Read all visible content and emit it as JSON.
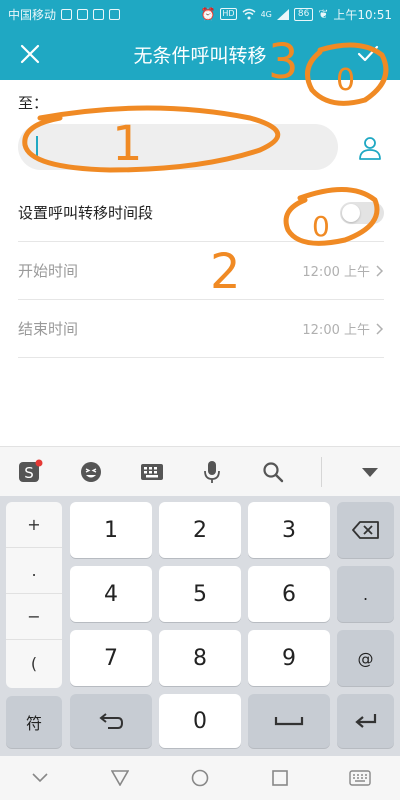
{
  "status_bar": {
    "carrier": "中国移动",
    "network_badge": "HD",
    "signal_text": "4G",
    "battery": "86",
    "time": "上午10:51"
  },
  "header": {
    "title": "无条件呼叫转移",
    "close_icon": "close-icon",
    "confirm_icon": "check-icon"
  },
  "form": {
    "to_label": "至：",
    "number_value": "",
    "number_placeholder": "",
    "schedule_label": "设置呼叫转移时间段",
    "schedule_enabled": false,
    "start_label": "开始时间",
    "start_value": "12:00 上午",
    "end_label": "结束时间",
    "end_value": "12:00 上午"
  },
  "keyboard": {
    "toolbar": [
      "sogou-logo-icon",
      "emoji-icon",
      "keyboard-icon",
      "mic-icon",
      "search-icon",
      "collapse-icon"
    ],
    "side_keys": [
      "+",
      ".",
      "−",
      "("
    ],
    "symbol_key": "符",
    "digits": [
      "1",
      "2",
      "3",
      "4",
      "5",
      "6",
      "7",
      "8",
      "9",
      "0"
    ],
    "dot_key": ".",
    "at_key": "@"
  },
  "scribbles": {
    "color": "#f08a24",
    "labels": [
      "1",
      "2",
      "3",
      "0",
      "0"
    ]
  },
  "colors": {
    "accent": "#1fa8c3"
  }
}
